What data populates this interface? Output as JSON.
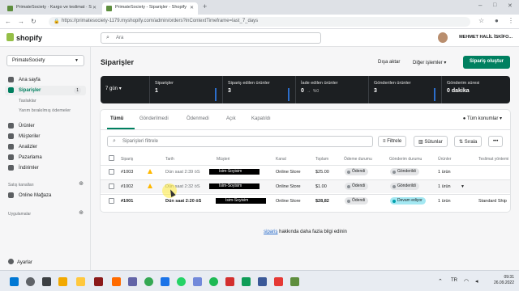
{
  "browser": {
    "tabs": [
      {
        "label": "PrimateSociety · Kargo ve teslimat · S"
      },
      {
        "label": "PrimateSociety - Siparişler - Shopify"
      }
    ],
    "url": "https://primatesociety-1179.myshopify.com/admin/orders?inContextTimeframe=last_7_days"
  },
  "topbar": {
    "logo": "shopify",
    "search_placeholder": "Ara",
    "user": "MEHMET HALİL İSKİFO..."
  },
  "sidebar": {
    "store": "PrimateSociety",
    "items": [
      {
        "label": "Ana sayfa"
      },
      {
        "label": "Siparişler",
        "badge": "1"
      },
      {
        "label": "Taslaklar"
      },
      {
        "label": "Yarım bırakılmış ödemeler"
      },
      {
        "label": "Ürünler"
      },
      {
        "label": "Müşteriler"
      },
      {
        "label": "Analizler"
      },
      {
        "label": "Pazarlama"
      },
      {
        "label": "İndirimler"
      }
    ],
    "sales_channels": "Satış kanalları",
    "online_store": "Online Mağaza",
    "apps": "Uygulamalar",
    "settings": "Ayarlar"
  },
  "main": {
    "title": "Siparişler",
    "export": "Dışa aktar",
    "other_actions": "Diğer işlemler",
    "create": "Sipariş oluştur",
    "days": "7 gün",
    "stats": [
      {
        "label": "Siparişler",
        "value": "1"
      },
      {
        "label": "Sipariş edilen ürünler",
        "value": "3"
      },
      {
        "label": "İade edilen ürünler",
        "value": "0",
        "delta": "%0"
      },
      {
        "label": "Gönderilen ürünler",
        "value": "3"
      },
      {
        "label": "Gönderim süresi",
        "value": "0 dakika"
      }
    ],
    "tabs": [
      "Tümü",
      "Gönderilmedi",
      "Ödenmedi",
      "Açık",
      "Kapatıldı"
    ],
    "timezones": "Tüm konumlar",
    "filter_placeholder": "Siparişleri filtrele",
    "filter_btn": "Filtrele",
    "columns_btn": "Sütunlar",
    "sort_btn": "Sırala",
    "more_btn": "•••",
    "headers": [
      "Sipariş",
      "Tarih",
      "Müşteri",
      "Kanal",
      "Toplam",
      "Ödeme durumu",
      "Gönderim durumu",
      "Ürünler",
      "Teslimat yöntemi"
    ],
    "rows": [
      {
        "order": "#1003",
        "date": "Dün saat 2:39 öS",
        "customer": "İsim-Soyisim",
        "channel": "Online Store",
        "total": "$25.00",
        "payment": "Ödendi",
        "fulfillment": "Gönderildi",
        "items": "1 ürün",
        "delivery": ""
      },
      {
        "order": "#1002",
        "date": "Dün saat 2:32 öS",
        "customer": "İsim-Soyisim",
        "channel": "Online Store",
        "total": "$1.00",
        "payment": "Ödendi",
        "fulfillment": "Gönderildi",
        "items": "1 ürün",
        "delivery": ""
      },
      {
        "order": "#1001",
        "date": "Dün saat 2:20 öS",
        "customer": "İsim-Soyisim",
        "channel": "Online Store",
        "total": "$28,82",
        "payment": "Ödendi",
        "fulfillment": "Devam ediyor",
        "items": "1 ürün",
        "delivery": "Standard Ship"
      }
    ],
    "learn_link": "sipariş",
    "learn_text": " hakkında daha fazla bilgi edinin"
  },
  "taskbar": {
    "time": "09:31",
    "date": "26.09.2022"
  }
}
